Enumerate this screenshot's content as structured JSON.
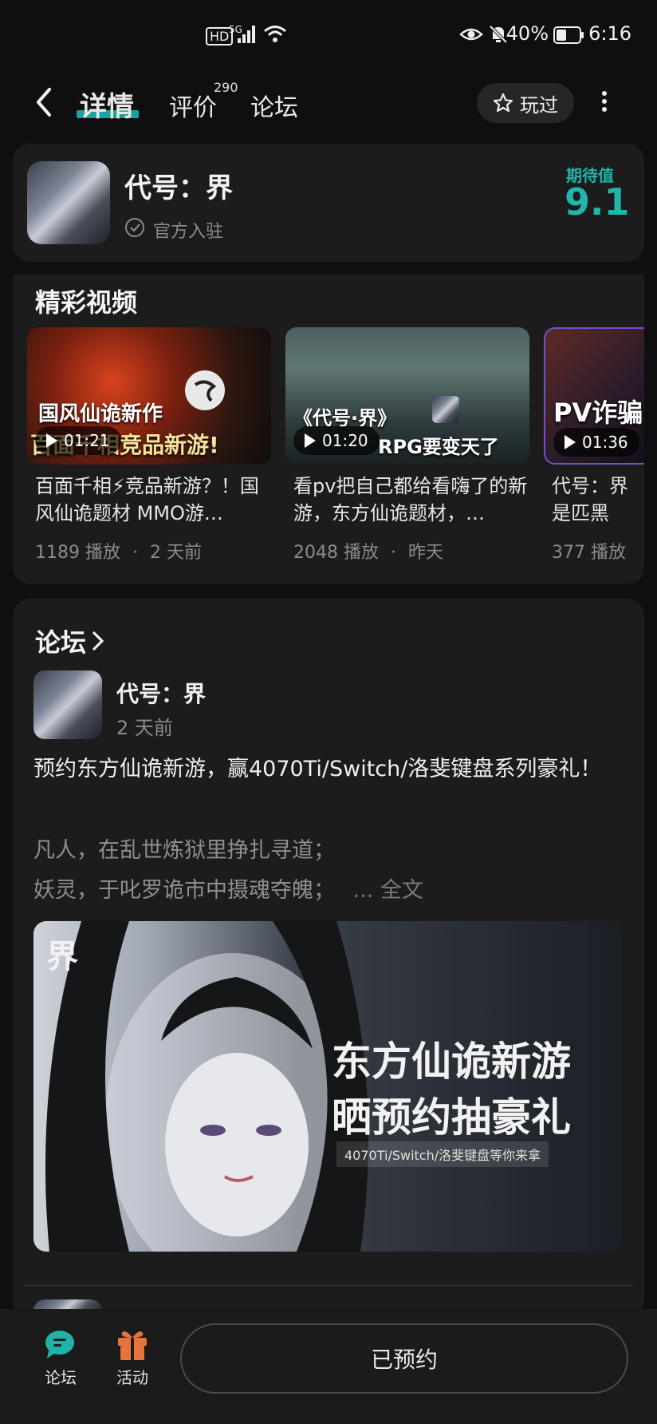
{
  "status_bar": {
    "network_left": "HD",
    "network_type": "5G",
    "battery_pct": "40%",
    "time": "6:16"
  },
  "header": {
    "tabs": [
      {
        "label": "详情",
        "active": true
      },
      {
        "label": "评价",
        "badge": "290"
      },
      {
        "label": "论坛"
      }
    ],
    "played_label": "玩过"
  },
  "game": {
    "title": "代号：界",
    "official_label": "官方入驻",
    "rating_label": "期待值",
    "rating_value": "9.1"
  },
  "videos_section": {
    "title": "精彩视频",
    "items": [
      {
        "thumb_text_top": "国风仙诡新作",
        "thumb_text_bottom": "百面千相竞品新游!",
        "duration": "01:21",
        "title": "百面千相⚡竞品新游？！国风仙诡题材 MMO游…",
        "plays": "1189 播放",
        "age": "2 天前"
      },
      {
        "thumb_text_top": "《代号·界》",
        "thumb_text_bottom": "RPG要变天了",
        "duration": "01:20",
        "title": "看pv把自己都给看嗨了的新游，东方仙诡题材，…",
        "plays": "2048 播放",
        "age": "昨天"
      },
      {
        "thumb_text_top": "PV诈骗",
        "thumb_text_bottom": "",
        "duration": "01:36",
        "title": "代号：界是匹黑马？纠",
        "plays": "377 播放",
        "age": ""
      }
    ]
  },
  "forum_section": {
    "title": "论坛",
    "post": {
      "author": "代号：界",
      "time": "2 天前",
      "title": "预约东方仙诡新游，赢4070Ti/Switch/洛斐键盘系列豪礼！",
      "body_line1": "凡人，在乱世炼狱里挣扎寻道；",
      "body_line2": "妖灵，于叱罗诡市中摄魂夺魄；",
      "more": "... 全文",
      "banner": {
        "logo": "界",
        "line1": "东方仙诡新游",
        "line2": "晒预约抽豪礼",
        "sub": "4070Ti/Switch/洛斐键盘等你来拿"
      }
    }
  },
  "bottom_bar": {
    "forum_label": "论坛",
    "activity_label": "活动",
    "reserved_label": "已预约"
  },
  "colors": {
    "accent": "#1fb3a8",
    "background": "#0f0f0f",
    "card": "#1c1c1c",
    "activity_icon": "#e8743b"
  },
  "icons": [
    "back-arrow-icon",
    "star-icon",
    "more-vertical-icon",
    "verified-check-icon",
    "play-icon",
    "chevron-right-icon",
    "forum-chat-icon",
    "gift-icon",
    "eye-icon",
    "mute-bell-icon",
    "wifi-icon",
    "signal-icon",
    "battery-icon"
  ]
}
